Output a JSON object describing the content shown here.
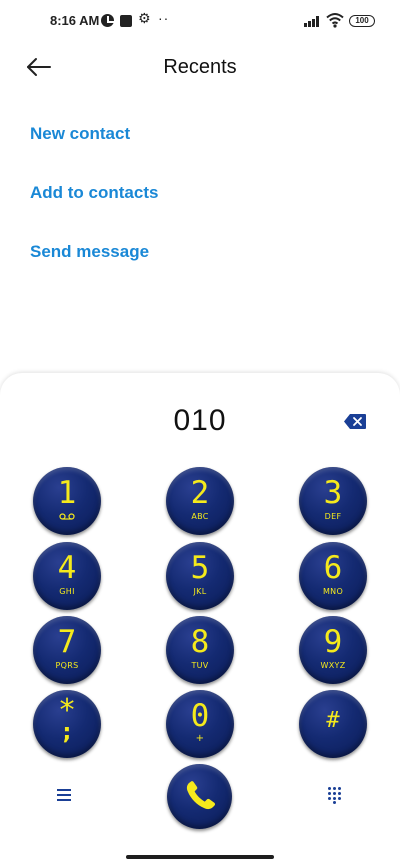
{
  "status_bar": {
    "time": "8:16 AM",
    "dots": "··",
    "battery": "100",
    "icons": [
      "clock-icon",
      "square-icon",
      "gear-icon",
      "signal-icon",
      "wifi-icon",
      "battery-icon"
    ]
  },
  "header": {
    "title": "Recents",
    "back_icon": "arrow-left-icon"
  },
  "actions": [
    {
      "label": "New contact"
    },
    {
      "label": "Add to contacts"
    },
    {
      "label": "Send message"
    }
  ],
  "dialpad": {
    "number": "010",
    "keys": [
      {
        "digit": "1",
        "letters": "",
        "icon": "voicemail-icon"
      },
      {
        "digit": "2",
        "letters": "ABC"
      },
      {
        "digit": "3",
        "letters": "DEF"
      },
      {
        "digit": "4",
        "letters": "GHI"
      },
      {
        "digit": "5",
        "letters": "JKL"
      },
      {
        "digit": "6",
        "letters": "MNO"
      },
      {
        "digit": "7",
        "letters": "PQRS"
      },
      {
        "digit": "8",
        "letters": "TUV"
      },
      {
        "digit": "9",
        "letters": "WXYZ"
      },
      {
        "digit": "*",
        "letters": ";"
      },
      {
        "digit": "0",
        "letters": "+"
      },
      {
        "digit": "#",
        "letters": ""
      }
    ],
    "colors": {
      "key_face": "#142a72",
      "key_text": "#f5ea1c",
      "accent": "#1a88d6"
    }
  }
}
